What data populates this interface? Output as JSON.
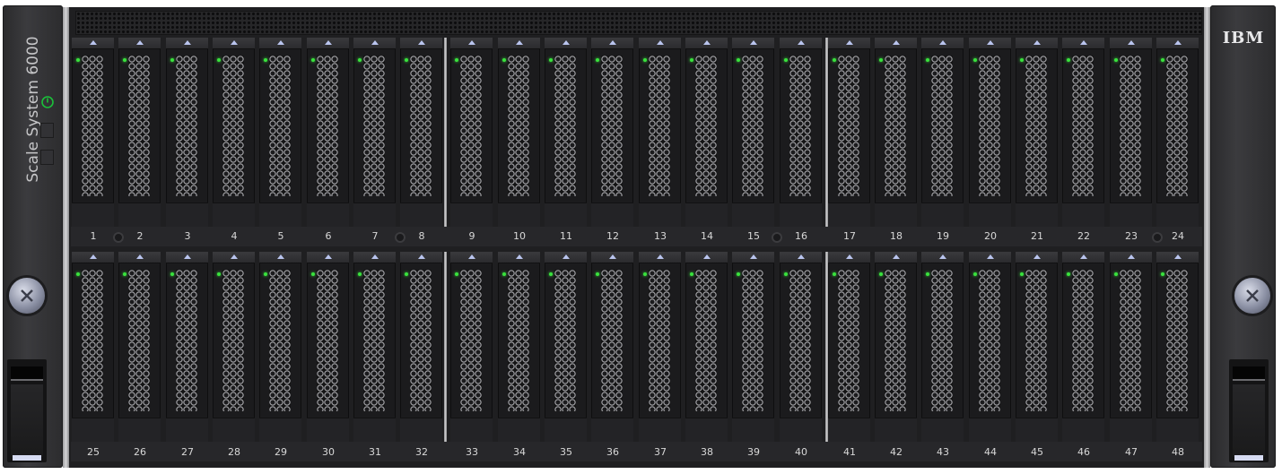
{
  "enclosure": {
    "product_name": "Scale System 6000",
    "brand": "IBM"
  },
  "drives": {
    "top_row": [
      "1",
      "2",
      "3",
      "4",
      "5",
      "6",
      "7",
      "8",
      "9",
      "10",
      "11",
      "12",
      "13",
      "14",
      "15",
      "16",
      "17",
      "18",
      "19",
      "20",
      "21",
      "22",
      "23",
      "24"
    ],
    "bottom_row": [
      "25",
      "26",
      "27",
      "28",
      "29",
      "30",
      "31",
      "32",
      "33",
      "34",
      "35",
      "36",
      "37",
      "38",
      "39",
      "40",
      "41",
      "42",
      "43",
      "44",
      "45",
      "46",
      "47",
      "48"
    ]
  },
  "status": {
    "drive_activity_led_color": "#39e23d",
    "power_led_color": "#1bbf3a",
    "release_tab_color": "#b9c4ee"
  }
}
